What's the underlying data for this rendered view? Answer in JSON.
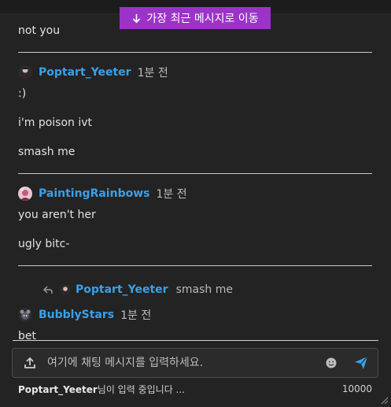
{
  "jump": {
    "label": "가장 최근 메시지로 이동"
  },
  "messages": {
    "m0_line": "not you",
    "m1": {
      "user": "Poptart_Yeeter",
      "time": "1분 전",
      "lines": [
        ":)",
        "i'm poison ivt",
        "smash me"
      ]
    },
    "m2": {
      "user": "PaintingRainbows",
      "time": "1분 전",
      "lines": [
        "you aren't her",
        "ugly bitc-"
      ]
    },
    "reply": {
      "user": "Poptart_Yeeter",
      "snippet": "smash me"
    },
    "m3": {
      "user": "BubblyStars",
      "time": "1분 전",
      "lines": [
        "bet"
      ]
    }
  },
  "composer": {
    "placeholder": "여기에 채팅 메시지를 입력하세요.",
    "value": ""
  },
  "footer": {
    "typing_user": "Poptart_Yeeter",
    "typing_suffix": "님이 입력 중입니다 ...",
    "char_limit": "10000"
  },
  "colors": {
    "accent": "#9b33c9",
    "username": "#3aa0e8",
    "send": "#3aa0e8"
  },
  "icons": [
    "arrow-down-icon",
    "reply-arrow-icon",
    "upload-icon",
    "emoji-icon",
    "send-icon",
    "resize-grip-icon"
  ]
}
